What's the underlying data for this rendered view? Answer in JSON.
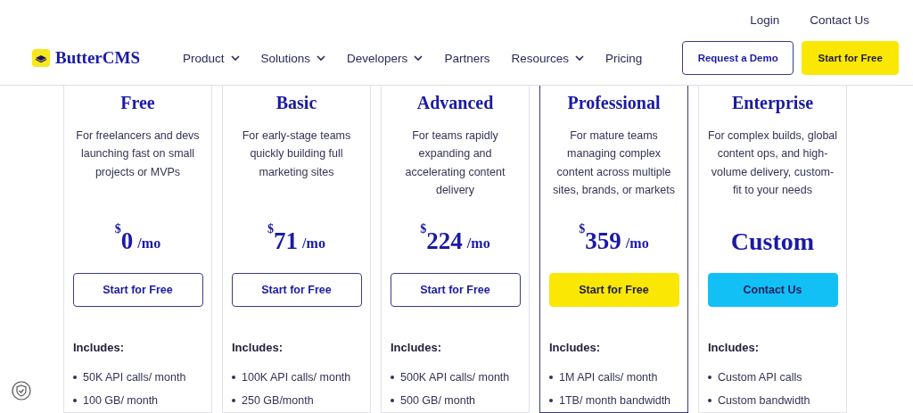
{
  "top_links": [
    "Login",
    "Contact Us"
  ],
  "logo": {
    "text": "ButterCMS"
  },
  "nav": [
    {
      "label": "Product",
      "has_menu": true
    },
    {
      "label": "Solutions",
      "has_menu": true
    },
    {
      "label": "Developers",
      "has_menu": true
    },
    {
      "label": "Partners",
      "has_menu": false
    },
    {
      "label": "Resources",
      "has_menu": true
    },
    {
      "label": "Pricing",
      "has_menu": false
    }
  ],
  "header_buttons": [
    {
      "label": "Request a Demo",
      "kind": "outline"
    },
    {
      "label": "Start for Free",
      "kind": "primary"
    }
  ],
  "plans": [
    {
      "name": "Free",
      "description": "For freelancers and devs launching fast on small projects or MVPs",
      "price": {
        "kind": "amount",
        "currency": "$",
        "amount": "0",
        "period": "/mo"
      },
      "button": {
        "label": "Start for Free",
        "kind": "outline"
      },
      "highlighted": false,
      "includes_title": "Includes:",
      "features": [
        "50K API calls/ month",
        "100 GB/ month"
      ]
    },
    {
      "name": "Basic",
      "description": "For early-stage teams quickly building full marketing sites",
      "price": {
        "kind": "amount",
        "currency": "$",
        "amount": "71",
        "period": "/mo"
      },
      "button": {
        "label": "Start for Free",
        "kind": "outline"
      },
      "highlighted": false,
      "includes_title": "Includes:",
      "features": [
        "100K API calls/ month",
        "250 GB/month"
      ]
    },
    {
      "name": "Advanced",
      "description": "For teams rapidly expanding and accelerating content delivery",
      "price": {
        "kind": "amount",
        "currency": "$",
        "amount": "224",
        "period": "/mo"
      },
      "button": {
        "label": "Start for Free",
        "kind": "outline"
      },
      "highlighted": false,
      "includes_title": "Includes:",
      "features": [
        "500K API calls/ month",
        "500 GB/ month"
      ]
    },
    {
      "name": "Professional",
      "description": "For mature teams managing complex content across multiple sites, brands, or markets",
      "price": {
        "kind": "amount",
        "currency": "$",
        "amount": "359",
        "period": "/mo"
      },
      "button": {
        "label": "Start for Free",
        "kind": "primary"
      },
      "highlighted": true,
      "includes_title": "Includes:",
      "features": [
        "1M API calls/ month",
        "1TB/ month bandwidth"
      ]
    },
    {
      "name": "Enterprise",
      "description": "For complex builds, global content ops, and high-volume delivery, custom-fit to your needs",
      "price": {
        "kind": "custom",
        "text": "Custom"
      },
      "button": {
        "label": "Contact Us",
        "kind": "accent"
      },
      "highlighted": false,
      "includes_title": "Includes:",
      "features": [
        "Custom API calls",
        "Custom bandwidth"
      ]
    }
  ]
}
